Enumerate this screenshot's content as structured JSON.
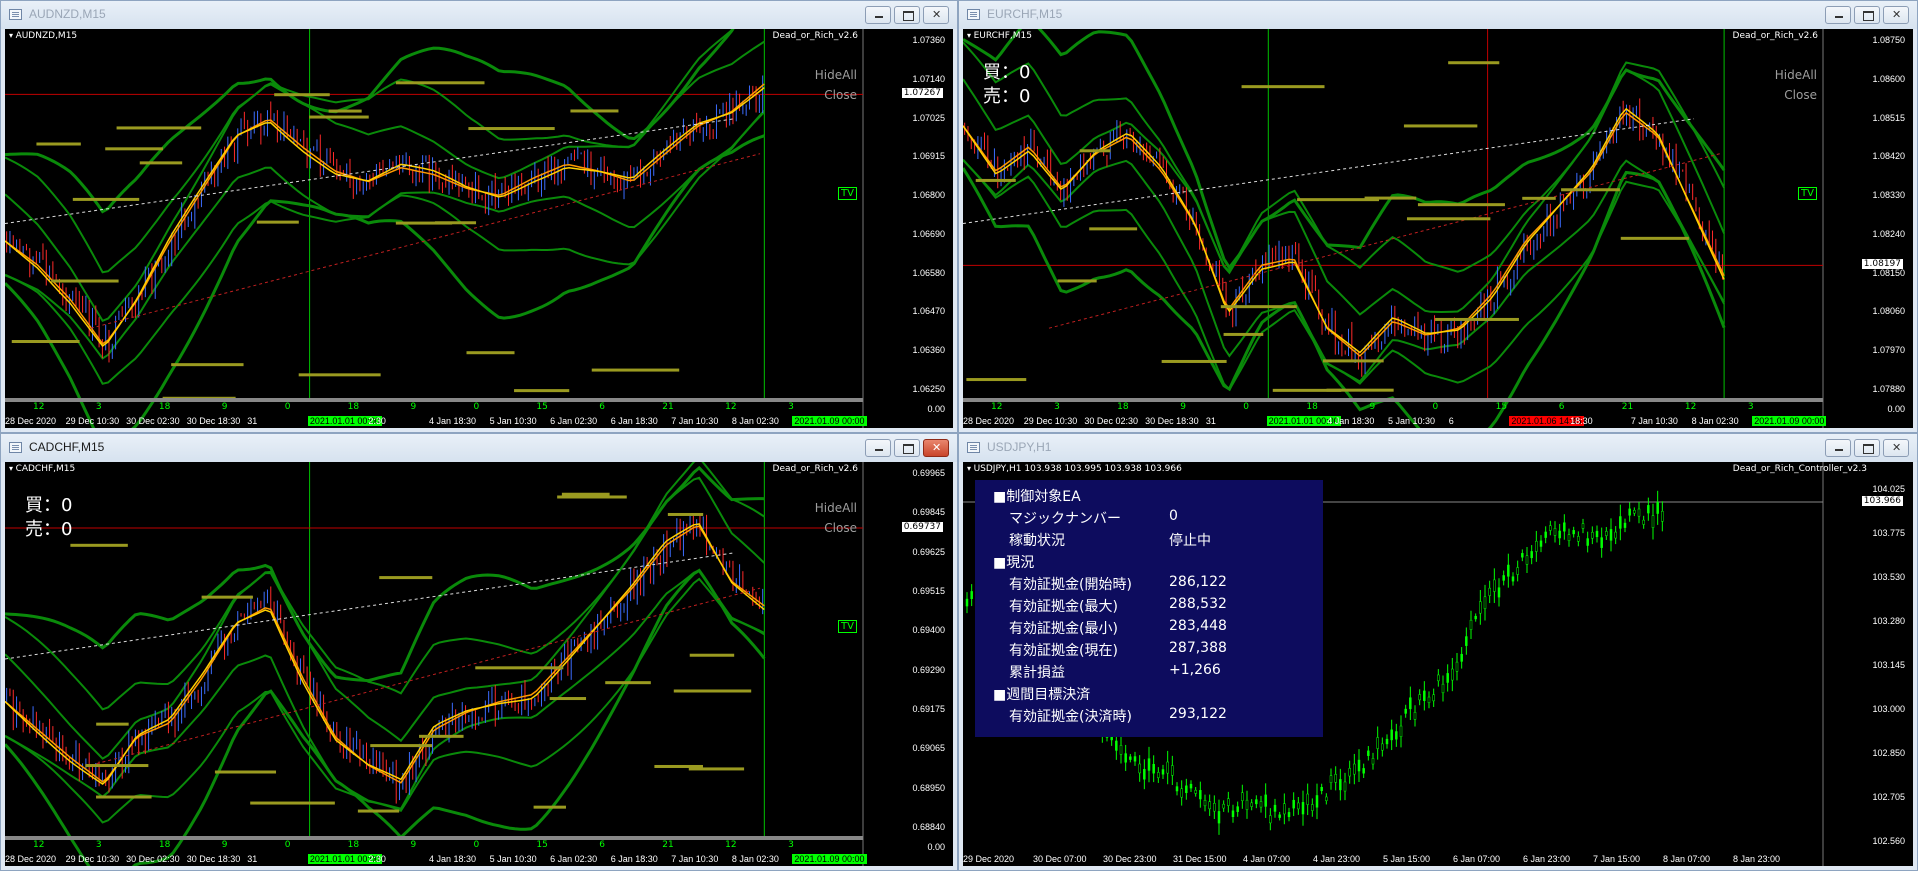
{
  "windows": [
    {
      "title": "AUDNZD,M15",
      "chart_label": "AUDNZD,M15",
      "ea_name": "Dead_or_Rich_v2.6",
      "hide_all": "HideAll",
      "close_label": "Close",
      "tv": "TV",
      "price_tag": "1.07267",
      "y_ticks": [
        "1.07360",
        "1.07140",
        "1.07025",
        "1.06915",
        "1.06800",
        "1.06690",
        "1.06580",
        "1.06470",
        "1.06360",
        "1.06250",
        "0.00"
      ],
      "x_labels": [
        "28 Dec 2020",
        "29 Dec 10:30",
        "30 Dec 02:30",
        "30 Dec 18:30",
        "31",
        "2021.01.01 00:00",
        "2:30",
        "4 Jan 18:30",
        "5 Jan 10:30",
        "6 Jan 02:30",
        "6 Jan 18:30",
        "7 Jan 10:30",
        "8 Jan 02:30",
        "2021.01.09 00:00"
      ],
      "num_labels": [
        "12",
        "3",
        "18",
        "9",
        "0",
        "18",
        "9",
        "0",
        "15",
        "6",
        "21",
        "12",
        "3"
      ]
    },
    {
      "title": "EURCHF,M15",
      "chart_label": "EURCHF,M15",
      "ea_name": "Dead_or_Rich_v2.6",
      "hide_all": "HideAll",
      "close_label": "Close",
      "tv": "TV",
      "buy": "買：0",
      "sell": "売：0",
      "price_tag": "1.08197",
      "y_ticks": [
        "1.08750",
        "1.08600",
        "1.08515",
        "1.08420",
        "1.08330",
        "1.08240",
        "1.08150",
        "1.08060",
        "1.07970",
        "1.07880",
        "0.00"
      ],
      "x_labels": [
        "28 Dec 2020",
        "29 Dec 10:30",
        "30 Dec 02:30",
        "30 Dec 18:30",
        "31",
        "2021.01.01 00:00",
        "4 Jan 18:30",
        "5 Jan 10:30",
        "6",
        "2021.01.06 14:45",
        "18:30",
        "7 Jan 10:30",
        "8 Jan 02:30",
        "2021.01.09 00:00"
      ],
      "num_labels": [
        "12",
        "3",
        "18",
        "9",
        "0",
        "18",
        "9",
        "0",
        "15",
        "6",
        "21",
        "12",
        "3"
      ]
    },
    {
      "title": "CADCHF,M15",
      "chart_label": "CADCHF,M15",
      "ea_name": "Dead_or_Rich_v2.6",
      "hide_all": "HideAll",
      "close_label": "Close",
      "tv": "TV",
      "buy": "買：0",
      "sell": "売：0",
      "price_tag": "0.69737",
      "y_ticks": [
        "0.69965",
        "0.69845",
        "0.69625",
        "0.69515",
        "0.69400",
        "0.69290",
        "0.69175",
        "0.69065",
        "0.68950",
        "0.68840",
        "0.00"
      ],
      "x_labels": [
        "28 Dec 2020",
        "29 Dec 10:30",
        "30 Dec 02:30",
        "30 Dec 18:30",
        "31",
        "2021.01.01 00:00",
        "2:30",
        "4 Jan 18:30",
        "5 Jan 10:30",
        "6 Jan 02:30",
        "6 Jan 18:30",
        "7 Jan 10:30",
        "8 Jan 02:30",
        "2021.01.09 00:00"
      ],
      "num_labels": [
        "12",
        "3",
        "18",
        "9",
        "0",
        "18",
        "9",
        "0",
        "15",
        "6",
        "21",
        "12",
        "3"
      ]
    },
    {
      "title": "USDJPY,H1",
      "chart_label": "USDJPY,H1  103.938 103.995 103.938 103.966",
      "ea_name": "Dead_or_Rich_Controller_v2.3",
      "price_tag": "103.966",
      "y_ticks": [
        "104.025",
        "103.775",
        "103.530",
        "103.280",
        "103.145",
        "103.000",
        "102.850",
        "102.705",
        "102.560"
      ],
      "x_labels": [
        "29 Dec 2020",
        "30 Dec 07:00",
        "30 Dec 23:00",
        "31 Dec 15:00",
        "4 Jan 07:00",
        "4 Jan 23:00",
        "5 Jan 15:00",
        "6 Jan 07:00",
        "6 Jan 23:00",
        "7 Jan 15:00",
        "8 Jan 07:00",
        "8 Jan 23:00"
      ],
      "panel": {
        "section1": "■制御対象EA",
        "magic_label": "マジックナンバー",
        "magic_value": "0",
        "status_label": "稼動状況",
        "status_value": "停止中",
        "section2": "■現況",
        "eq_start_label": "有効証拠金(開始時)",
        "eq_start_value": "286,122",
        "eq_max_label": "有効証拠金(最大)",
        "eq_max_value": "288,532",
        "eq_min_label": "有効証拠金(最小)",
        "eq_min_value": "283,448",
        "eq_now_label": "有効証拠金(現在)",
        "eq_now_value": "287,388",
        "pnl_label": "累計損益",
        "pnl_value": "+1,266",
        "section3": "■週間目標決済",
        "eq_settle_label": "有効証拠金(決済時)",
        "eq_settle_value": "293,122"
      }
    }
  ],
  "colors": {
    "candle_up": "#3b6cff",
    "candle_dn": "#ff2a2a",
    "band": "#0a8a0a",
    "ma": "#ff9900",
    "level": "#9a9a20",
    "usdjpy_candle": "#00ff00"
  }
}
